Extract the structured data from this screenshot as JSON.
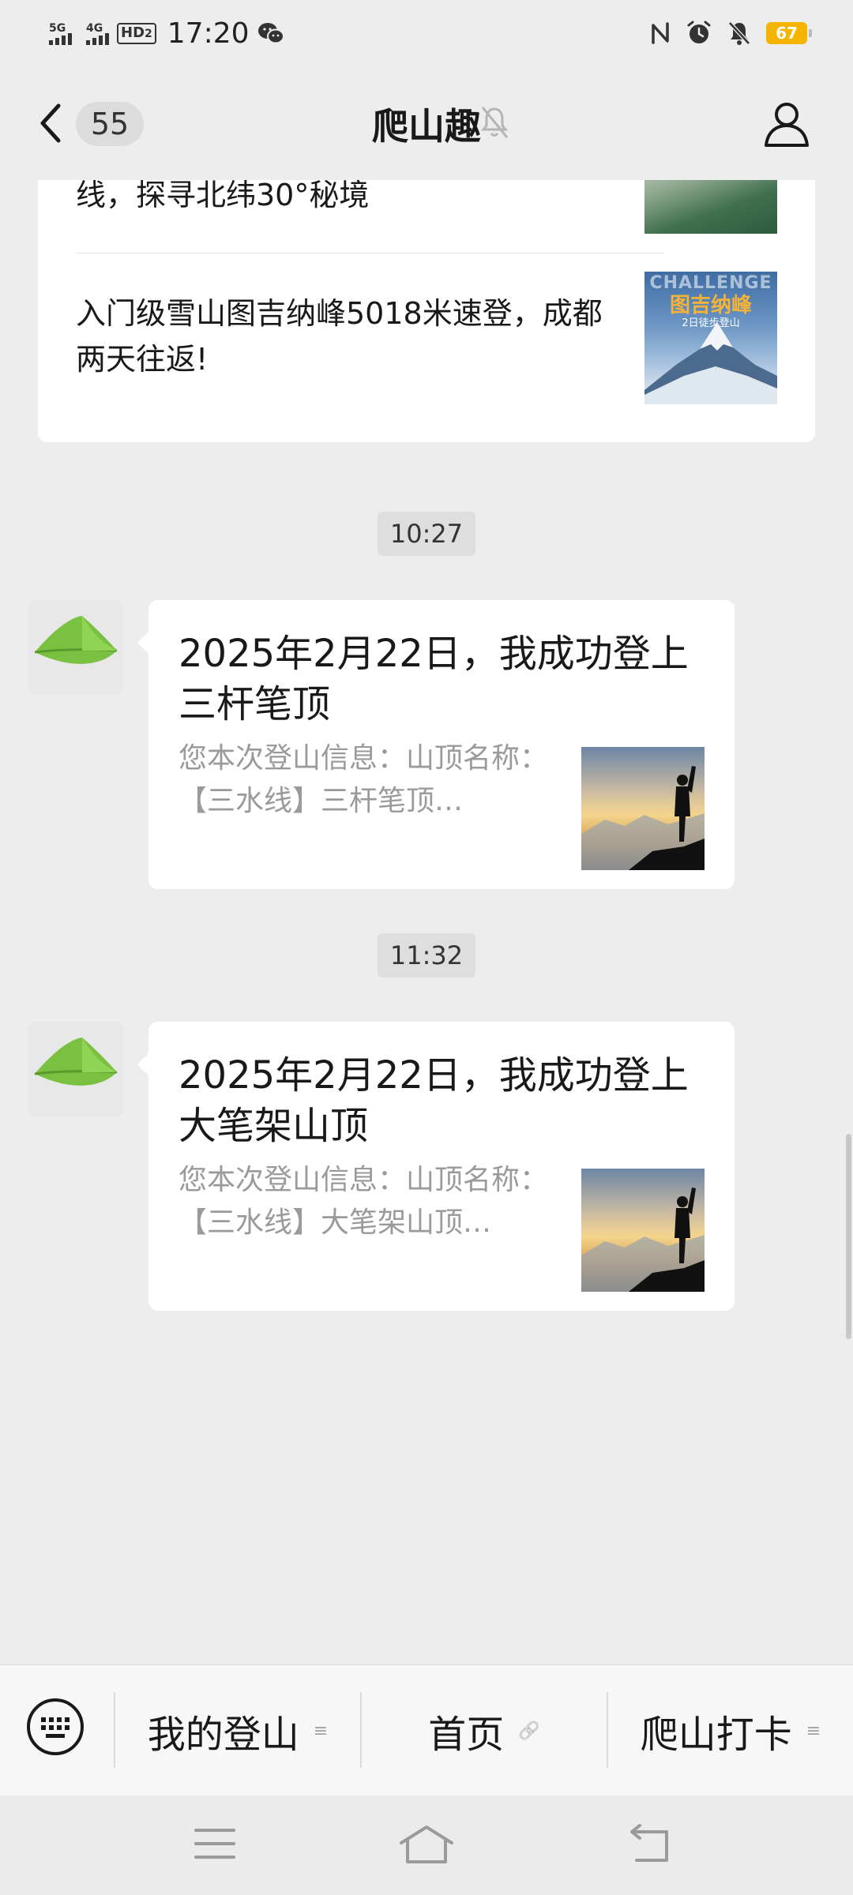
{
  "status_bar": {
    "signal1_label": "5G",
    "signal2_label": "4G",
    "hd_label": "HD",
    "hd_sub": "2",
    "time": "17:20",
    "battery": "67",
    "icons": [
      "nfc-icon",
      "alarm-icon",
      "bell-off-icon",
      "battery-icon"
    ]
  },
  "header": {
    "unread_count": "55",
    "title": "爬山趣"
  },
  "articles": [
    {
      "title": "线，探寻北纬30°秘境"
    },
    {
      "title": "入门级雪山图吉纳峰5018米速登，成都两天往返!",
      "thumb_top": "CHALLENGE",
      "thumb_main": "图吉纳峰",
      "thumb_sub": "2日徒步登山"
    }
  ],
  "timestamps": [
    "10:27",
    "11:32"
  ],
  "messages": [
    {
      "title": "2025年2月22日，我成功登上三杆笔顶",
      "desc": "您本次登山信息：山顶名称：【三水线】三杆笔顶…"
    },
    {
      "title": "2025年2月22日，我成功登上大笔架山顶",
      "desc": "您本次登山信息：山顶名称：【三水线】大笔架山顶…"
    }
  ],
  "menu": {
    "items": [
      {
        "label": "我的登山",
        "mark": "≡"
      },
      {
        "label": "首页",
        "mark": "🔗"
      },
      {
        "label": "爬山打卡",
        "mark": "≡"
      }
    ]
  },
  "colors": {
    "background": "#ededed",
    "bubble": "#ffffff",
    "secondary_text": "#9a9a9a",
    "battery": "#f4b400"
  }
}
